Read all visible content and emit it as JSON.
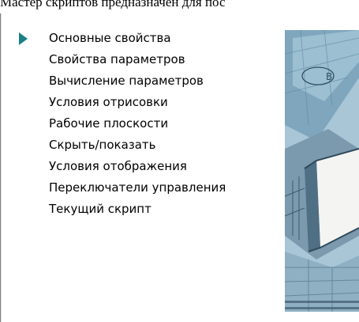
{
  "intro_text": "Мастер скриптов предназначен для пос",
  "steps": [
    {
      "label": "Основные свойства",
      "active": true
    },
    {
      "label": "Свойства параметров",
      "active": false
    },
    {
      "label": "Вычисление параметров",
      "active": false
    },
    {
      "label": "Условия отрисовки",
      "active": false
    },
    {
      "label": "Рабочие плоскости",
      "active": false
    },
    {
      "label": "Скрыть/показать",
      "active": false
    },
    {
      "label": "Условия отображения",
      "active": false
    },
    {
      "label": "Переключатели управления",
      "active": false
    },
    {
      "label": "Текущий скрипт",
      "active": false
    }
  ],
  "artwork": {
    "callout_letter": "B"
  },
  "colors": {
    "pointer": "#1a7f86",
    "text": "#000000",
    "background": "#ffffff"
  }
}
